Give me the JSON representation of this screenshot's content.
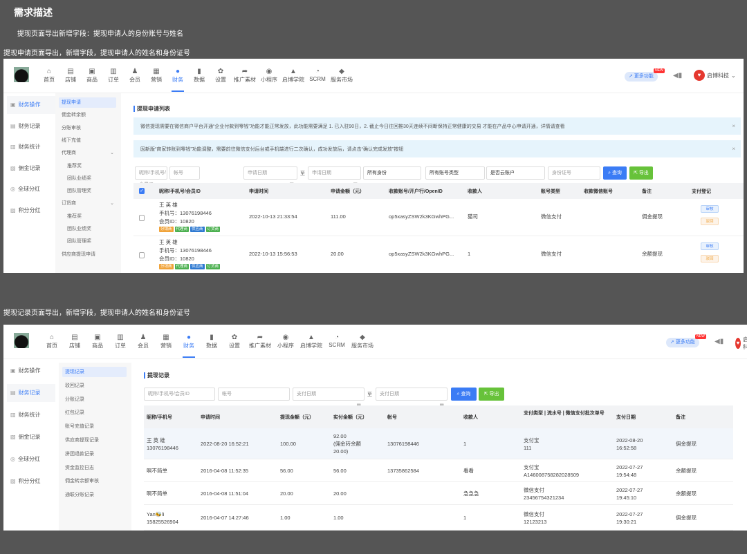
{
  "header": {
    "title": "需求描述",
    "description": "提现页面导出新增字段：提现申请人的身份账号与姓名"
  },
  "captions": {
    "apply": "提现申请页面导出，新增字段，提现申请人的姓名和身份证号",
    "record": "提现记录页面导出，新增字段，提现申请人的姓名和身份证号"
  },
  "colors": {
    "accent": "#3b7cf5",
    "export": "#67c23a",
    "bg": "#555555"
  },
  "nav": {
    "items": [
      {
        "label": "首页",
        "icon": "home-icon",
        "g": "⌂"
      },
      {
        "label": "店铺",
        "icon": "store-icon",
        "g": "▤"
      },
      {
        "label": "商品",
        "icon": "goods-icon",
        "g": "▣"
      },
      {
        "label": "订单",
        "icon": "order-icon",
        "g": "▥"
      },
      {
        "label": "会员",
        "icon": "member-icon",
        "g": "♟"
      },
      {
        "label": "营销",
        "icon": "marketing-icon",
        "g": "▦"
      },
      {
        "label": "财务",
        "icon": "finance-icon",
        "g": "●",
        "active": true
      },
      {
        "label": "数据",
        "icon": "data-icon",
        "g": "▮"
      },
      {
        "label": "设置",
        "icon": "gear-icon",
        "g": "✿"
      },
      {
        "label": "推广素材",
        "icon": "share-icon",
        "g": "➦"
      },
      {
        "label": "小程序",
        "icon": "miniapp-icon",
        "g": "◉"
      },
      {
        "label": "启博学院",
        "icon": "academy-icon",
        "g": "▲"
      },
      {
        "label": "SCRM",
        "icon": "pie-icon",
        "g": "◔"
      },
      {
        "label": "服务市场",
        "icon": "market-icon",
        "g": "◆"
      }
    ],
    "more": "更多功能",
    "new_badge": "NEW",
    "brand": "启博科技"
  },
  "sidebar": [
    "财务操作",
    "财务记录",
    "财务统计",
    "佣金记录",
    "全球分红",
    "积分分红"
  ],
  "apply": {
    "submenu": [
      {
        "label": "提现申请",
        "active": true
      },
      {
        "label": "佣金转余额"
      },
      {
        "label": "分账审核"
      },
      {
        "label": "线下充值"
      },
      {
        "label": "代理商",
        "chev": true
      },
      {
        "label": "推荐奖",
        "sub": true
      },
      {
        "label": "团队业绩奖",
        "sub": true
      },
      {
        "label": "团队管理奖",
        "sub": true
      },
      {
        "label": "订货商",
        "chev": true
      },
      {
        "label": "推荐奖",
        "sub": true
      },
      {
        "label": "团队业绩奖",
        "sub": true
      },
      {
        "label": "团队管理奖",
        "sub": true
      },
      {
        "label": "供应商提现申请"
      }
    ],
    "title": "提现申请列表",
    "notices": [
      "微信提现需要在微信商户平台开通“企业付款到零钱”功能才能正常发放，此功能需要满足 1. 已入驻90日，2. 截止今日往回推30天连续不间断保持正常健康的交易 才能在产品中心申请开通，详情请查看",
      "因新版“商家转账到零钱”功能调整，需要前往微信支付后台或手机端进行二次确认，成功发放后，请点击“确认完成发放”按钮"
    ],
    "filters": {
      "name": "昵称/手机号/会员ID",
      "account": "帐号",
      "date1": "申请日期",
      "to": "至",
      "date2": "申请日期",
      "identity": "所有身份",
      "acctype": "所有账号类型",
      "cloud": "是否云账户",
      "idcard": "身份证号",
      "search": "查询",
      "export": "导出"
    },
    "columns": [
      "昵称/手机号/会员ID",
      "申请时间",
      "申请金额（元）",
      "收款账号/开户行/OpenID",
      "收款人",
      "账号类型",
      "收款微信账号",
      "备注",
      "支付登记"
    ],
    "tags": [
      "分销商",
      "代理商",
      "供应商",
      "订货商"
    ],
    "actions": {
      "approve": "审核",
      "reject": "驳回"
    },
    "rows": [
      {
        "name": "王 英 雄",
        "phone": "手机号：13076198446",
        "member": "会员ID：10820",
        "time": "2022-10-13 21:33:54",
        "amount": "111.00",
        "account": "op5xasyZSW2k3KGwhPG...",
        "payee": "猫司",
        "type": "微信支付",
        "wechat": "",
        "remark": "佣金提现"
      },
      {
        "name": "王 英 雄",
        "phone": "手机号：13076198446",
        "member": "会员ID：10820",
        "time": "2022-10-13 15:56:53",
        "amount": "20.00",
        "account": "op5xasyZSW2k3KGwhPG...",
        "payee": "1",
        "type": "微信支付",
        "wechat": "",
        "remark": "余额提现"
      }
    ]
  },
  "record": {
    "submenu": [
      {
        "label": "提现记录",
        "active": true
      },
      {
        "label": "驳回记录"
      },
      {
        "label": "分账记录"
      },
      {
        "label": "红包记录"
      },
      {
        "label": "账号充值记录"
      },
      {
        "label": "供应商提现记录"
      },
      {
        "label": "拼团退款记录"
      },
      {
        "label": "资金监控日志"
      },
      {
        "label": "佣金转余额审核"
      },
      {
        "label": "通联分账记录"
      }
    ],
    "title": "提现记录",
    "filters": {
      "name": "昵称/手机号/会员ID",
      "account": "帐号",
      "date1": "支付日期",
      "to": "至",
      "date2": "支付日期",
      "search": "查询",
      "export": "导出"
    },
    "columns": [
      "昵称/手机号",
      "申请时间",
      "提现金额（元）",
      "实付金额（元）",
      "帐号",
      "收款人",
      "支付类型 | 流水号 | 微信支付批次单号",
      "支付日期",
      "备注"
    ],
    "rows": [
      [
        "王 英 雄\n13076198446",
        "2022-08-20 16:52:21",
        "100.00",
        "92.00\n(佣金转余额\n20.00)",
        "13076198446",
        "1",
        "支付宝\n111",
        "2022-08-20\n16:52:58",
        "佣金提现"
      ],
      [
        "啊不简单",
        "2016-04-08 11:52:35",
        "56.00",
        "56.00",
        "13735862584",
        "看看",
        "支付宝\nA146008758282028509",
        "2022-07-27\n19:54:48",
        "余额提现"
      ],
      [
        "啊不简单",
        "2016-04-08 11:51:04",
        "20.00",
        "20.00",
        "",
        "急急急",
        "微信支付\n23456754321234",
        "2022-07-27\n19:45:10",
        "余额提现"
      ],
      [
        "Yan🐝li\n15825526904",
        "2016-04-07 14:27:46",
        "1.00",
        "1.00",
        "",
        "1",
        "微信支付\n12123213",
        "2022-07-27\n19:30:21",
        "佣金提现"
      ]
    ]
  }
}
